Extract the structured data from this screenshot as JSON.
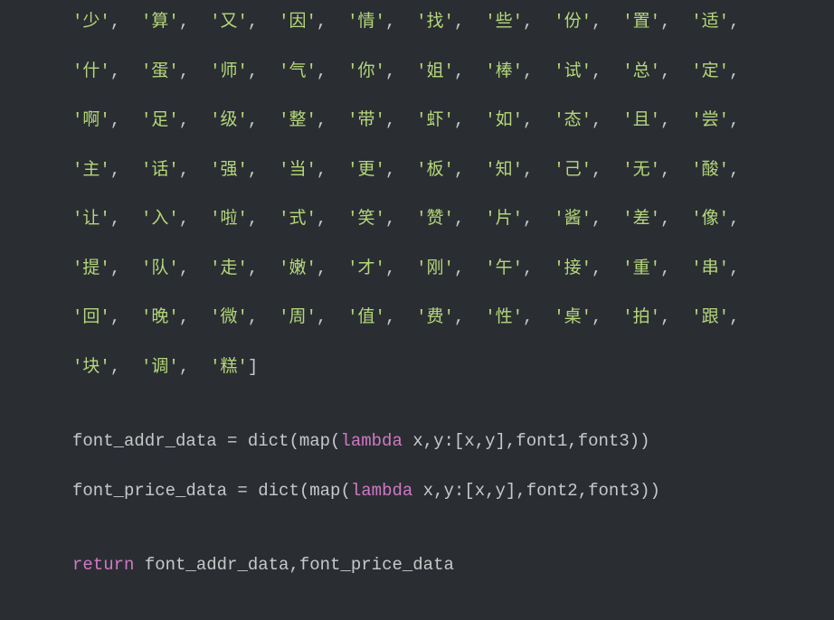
{
  "rows": [
    [
      "少",
      "算",
      "又",
      "因",
      "情",
      "找",
      "些",
      "份",
      "置",
      "适"
    ],
    [
      "什",
      "蛋",
      "师",
      "气",
      "你",
      "姐",
      "棒",
      "试",
      "总",
      "定"
    ],
    [
      "啊",
      "足",
      "级",
      "整",
      "带",
      "虾",
      "如",
      "态",
      "且",
      "尝"
    ],
    [
      "主",
      "话",
      "强",
      "当",
      "更",
      "板",
      "知",
      "己",
      "无",
      "酸"
    ],
    [
      "让",
      "入",
      "啦",
      "式",
      "笑",
      "赞",
      "片",
      "酱",
      "差",
      "像"
    ],
    [
      "提",
      "队",
      "走",
      "嫩",
      "才",
      "刚",
      "午",
      "接",
      "重",
      "串"
    ],
    [
      "回",
      "晚",
      "微",
      "周",
      "值",
      "费",
      "性",
      "桌",
      "拍",
      "跟"
    ],
    [
      "块",
      "调",
      "糕"
    ]
  ],
  "code": {
    "l1_a": "font_addr_data = dict(map(",
    "l1_k": "lambda",
    "l1_b": " x,y:[x,y],font1,font3))",
    "l2_a": "font_price_data = dict(map(",
    "l2_k": "lambda",
    "l2_b": " x,y:[x,y],font2,font3))",
    "l3_k": "return",
    "l3_b": " font_addr_data,font_price_data"
  }
}
